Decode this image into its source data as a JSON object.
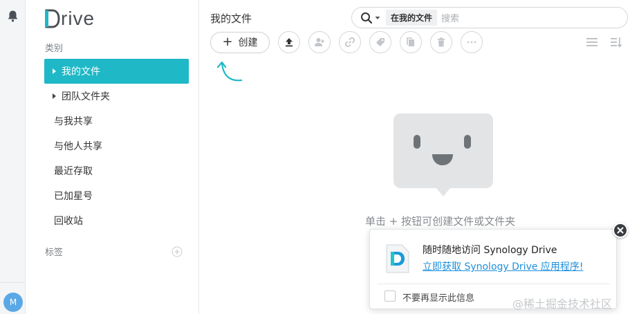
{
  "rail": {
    "avatar_initial": "M",
    "notification_icon": "bell-icon"
  },
  "nav": {
    "logo_first": "D",
    "logo_rest": "rive",
    "category_label": "类别",
    "items": [
      {
        "label": "我的文件",
        "active": true,
        "caret": true
      },
      {
        "label": "团队文件夹",
        "active": false,
        "caret": true
      },
      {
        "label": "与我共享",
        "active": false,
        "caret": false
      },
      {
        "label": "与他人共享",
        "active": false,
        "caret": false
      },
      {
        "label": "最近存取",
        "active": false,
        "caret": false
      },
      {
        "label": "已加星号",
        "active": false,
        "caret": false
      },
      {
        "label": "回收站",
        "active": false,
        "caret": false
      }
    ],
    "tags_label": "标签"
  },
  "main": {
    "title": "我的文件",
    "search": {
      "scope": "在我的文件",
      "placeholder": "搜索"
    },
    "toolbar": {
      "create_label": "创建",
      "icons": [
        "upload-icon",
        "share-user-icon",
        "link-icon",
        "tag-icon",
        "copy-icon",
        "delete-icon",
        "more-icon"
      ]
    },
    "empty_text": "单击 + 按钮可创建文件或文件夹"
  },
  "popup": {
    "title": "随时随地访问 Synology Drive",
    "link": "立即获取 Synology Drive 应用程序!",
    "checkbox_label": "不要再显示此信息",
    "checked": false
  },
  "watermark": "@稀土掘金技术社区",
  "colors": {
    "accent": "#1fb8c6",
    "link": "#1d8fdd"
  }
}
